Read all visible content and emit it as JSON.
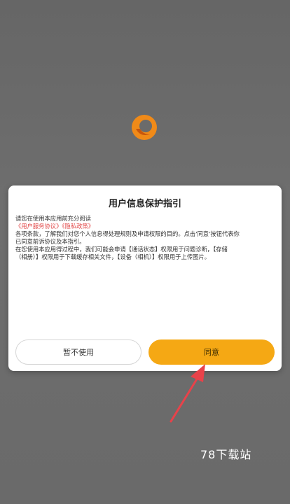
{
  "dialog": {
    "title": "用户信息保护指引",
    "intro": "请您在使用本应用前充分阅读",
    "links": "《用户服务协议》《隐私政策》",
    "para1_line1": "各项条款，了解我们对您个人信息得处理规则及申请权限的目的。点击'同意'按钮代表你",
    "para1_line2": "已同意前诉协议及本指引。",
    "para2_line1": "在您使用本应用得过程中，我们可能会申请【通话状态】权限用于问题诊断，【存储",
    "para2_line2": "（相册）】权限用于下载缓存相关文件，【设备（相机）】权限用于上传图片。",
    "reject_label": "暂不使用",
    "agree_label": "同意"
  },
  "watermark": "78下载站",
  "icons": {
    "logo": "app-logo-icon",
    "arrow": "pointer-arrow"
  },
  "colors": {
    "overlay": "#6b6b6b",
    "agree_button": "#f5a814",
    "link_text": "#e24a4a",
    "arrow": "#e8424a"
  }
}
